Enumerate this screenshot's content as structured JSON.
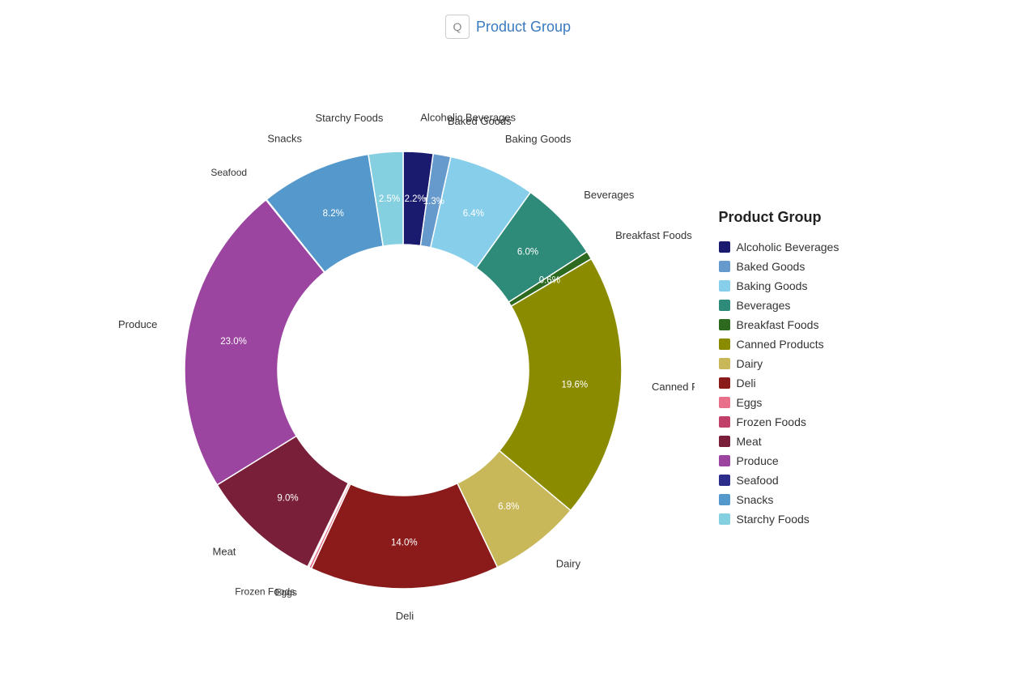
{
  "header": {
    "icon": "Q",
    "title": "Product Group"
  },
  "legend": {
    "title": "Product Group",
    "items": [
      {
        "label": "Alcoholic Beverages",
        "color": "#1a1a6e"
      },
      {
        "label": "Baked Goods",
        "color": "#6699cc"
      },
      {
        "label": "Baking Goods",
        "color": "#87ceeb"
      },
      {
        "label": "Beverages",
        "color": "#2e8b7a"
      },
      {
        "label": "Breakfast Foods",
        "color": "#2d6a1f"
      },
      {
        "label": "Canned Products",
        "color": "#8b8b00"
      },
      {
        "label": "Dairy",
        "color": "#c8b85a"
      },
      {
        "label": "Deli",
        "color": "#8b1a1a"
      },
      {
        "label": "Eggs",
        "color": "#e8708a"
      },
      {
        "label": "Frozen Foods",
        "color": "#c0406a"
      },
      {
        "label": "Meat",
        "color": "#7a1f3a"
      },
      {
        "label": "Produce",
        "color": "#9b45a0"
      },
      {
        "label": "Seafood",
        "color": "#2d2d8b"
      },
      {
        "label": "Snacks",
        "color": "#5599cc"
      },
      {
        "label": "Starchy Foods",
        "color": "#85d0e0"
      }
    ]
  },
  "chart": {
    "segments": [
      {
        "label": "Alcoholic Beverages",
        "pct": "2.2%",
        "color": "#1a1a6e"
      },
      {
        "label": "Baked Goods",
        "pct": "",
        "color": "#6699cc"
      },
      {
        "label": "Baking Goods",
        "pct": "6.4%",
        "color": "#87ceeb"
      },
      {
        "label": "Beverages",
        "pct": "6.0%",
        "color": "#2e8b7a"
      },
      {
        "label": "Breakfast Foods",
        "pct": "0.6%",
        "color": "#2d6a1f"
      },
      {
        "label": "Canned Products",
        "pct": "19.6%",
        "color": "#8b8b00"
      },
      {
        "label": "Dairy",
        "pct": "6.8%",
        "color": "#c8b85a"
      },
      {
        "label": "Deli",
        "pct": "14.0%",
        "color": "#8b1a1a"
      },
      {
        "label": "Eggs",
        "pct": "0.2%",
        "color": "#e8708a"
      },
      {
        "label": "Frozen Foods",
        "pct": "0.1%",
        "color": "#c0406a"
      },
      {
        "label": "Meat",
        "pct": "9.0%",
        "color": "#7a1f3a"
      },
      {
        "label": "Produce",
        "pct": "23.0%",
        "color": "#9b45a0"
      },
      {
        "label": "Seafood",
        "pct": "0.0%",
        "color": "#2d2d8b"
      },
      {
        "label": "Snacks",
        "pct": "8.2%",
        "color": "#5599cc"
      },
      {
        "label": "Starchy Foods",
        "pct": "",
        "color": "#85d0e0"
      }
    ]
  }
}
